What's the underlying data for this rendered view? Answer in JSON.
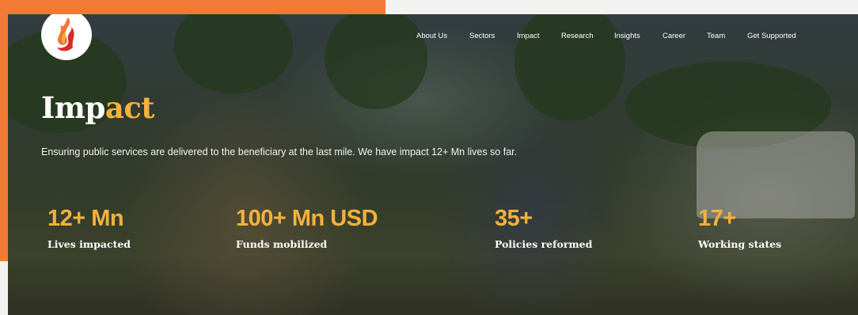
{
  "colors": {
    "accent": "#f6b23c",
    "frame": "#f07a36",
    "text": "#ffffff"
  },
  "logo": {
    "icon": "flame-logo-icon"
  },
  "nav": {
    "items": [
      {
        "label": "About Us"
      },
      {
        "label": "Sectors"
      },
      {
        "label": "Impact"
      },
      {
        "label": "Research"
      },
      {
        "label": "Insights"
      },
      {
        "label": "Career"
      },
      {
        "label": "Team"
      },
      {
        "label": "Get Supported"
      }
    ]
  },
  "hero": {
    "title_part1": "Imp",
    "title_part2": "act",
    "subtitle": "Ensuring public services are delivered to the beneficiary at the last mile. We have impact 12+ Mn lives so far."
  },
  "stats": [
    {
      "value": "12+ Mn",
      "label": "Lives impacted"
    },
    {
      "value": "100+ Mn USD",
      "label": "Funds mobilized"
    },
    {
      "value": "35+",
      "label": "Policies reformed"
    },
    {
      "value": "17+",
      "label": "Working states"
    }
  ]
}
